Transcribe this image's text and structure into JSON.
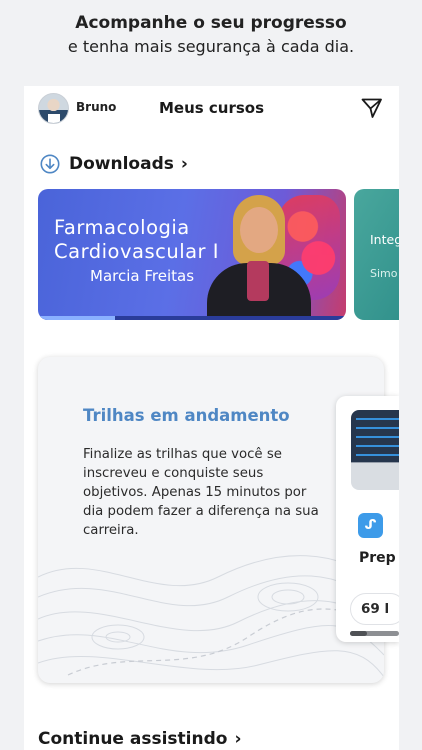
{
  "promo": {
    "title": "Acompanhe o seu progresso",
    "subtitle": "e tenha mais segurança à cada dia."
  },
  "header": {
    "username": "Bruno",
    "title": "Meus cursos",
    "send_icon": "send-icon",
    "avatar_icon": "avatar"
  },
  "downloads": {
    "label": "Downloads",
    "icon": "download-icon",
    "chevron": "›"
  },
  "courses": [
    {
      "title": "Farmacologia Cardiovascular I",
      "author": "Marcia Freitas",
      "progress": 0.25
    },
    {
      "title": "Integ e Cu",
      "author": "Simo"
    }
  ],
  "trilhas": {
    "title": "Trilhas em andamento",
    "description": "Finalize as trilhas que você se inscreveu e conquiste seus objetivos. Apenas 15 minutos por dia podem fazer a diferença na sua carreira.",
    "card": {
      "icon_symbol": "ᔑ",
      "name": "Prep",
      "count": "69 l",
      "progress": 0.35
    }
  },
  "continue": {
    "label": "Continue assistindo",
    "chevron": "›"
  },
  "colors": {
    "accent": "#4f87c4",
    "course_card": "#5b6fe6",
    "next_card": "#49a79d"
  }
}
